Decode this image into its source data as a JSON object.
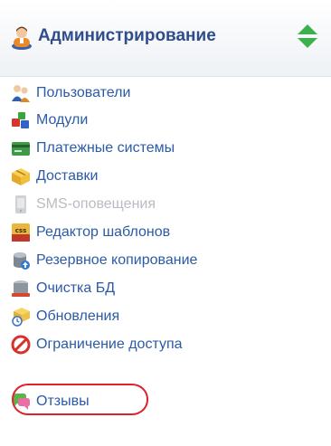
{
  "header": {
    "title": "Администрирование",
    "icon": "admin-user-icon",
    "toggle_icon": "up-down-arrows-icon"
  },
  "menu": {
    "items": [
      {
        "label": "Пользователи",
        "icon": "users-icon",
        "enabled": true
      },
      {
        "label": "Модули",
        "icon": "modules-icon",
        "enabled": true
      },
      {
        "label": "Платежные системы",
        "icon": "payment-card-icon",
        "enabled": true
      },
      {
        "label": "Доставки",
        "icon": "delivery-box-icon",
        "enabled": true
      },
      {
        "label": "SMS-оповещения",
        "icon": "sms-phone-icon",
        "enabled": false
      },
      {
        "label": "Редактор шаблонов",
        "icon": "css-icon",
        "enabled": true
      },
      {
        "label": "Резервное копирование",
        "icon": "backup-database-icon",
        "enabled": true
      },
      {
        "label": "Очистка БД",
        "icon": "clean-database-icon",
        "enabled": true
      },
      {
        "label": "Обновления",
        "icon": "updates-icon",
        "enabled": true
      },
      {
        "label": "Ограничение доступа",
        "icon": "no-access-icon",
        "enabled": true
      },
      {
        "label": "Отзывы",
        "icon": "reviews-chat-icon",
        "enabled": true,
        "highlighted": true
      }
    ]
  },
  "colors": {
    "link": "#2b5aa8",
    "title": "#2f4d8c",
    "disabled": "#b9bcc2",
    "highlight": "#e0202a",
    "toggle": "#3cb04a"
  }
}
